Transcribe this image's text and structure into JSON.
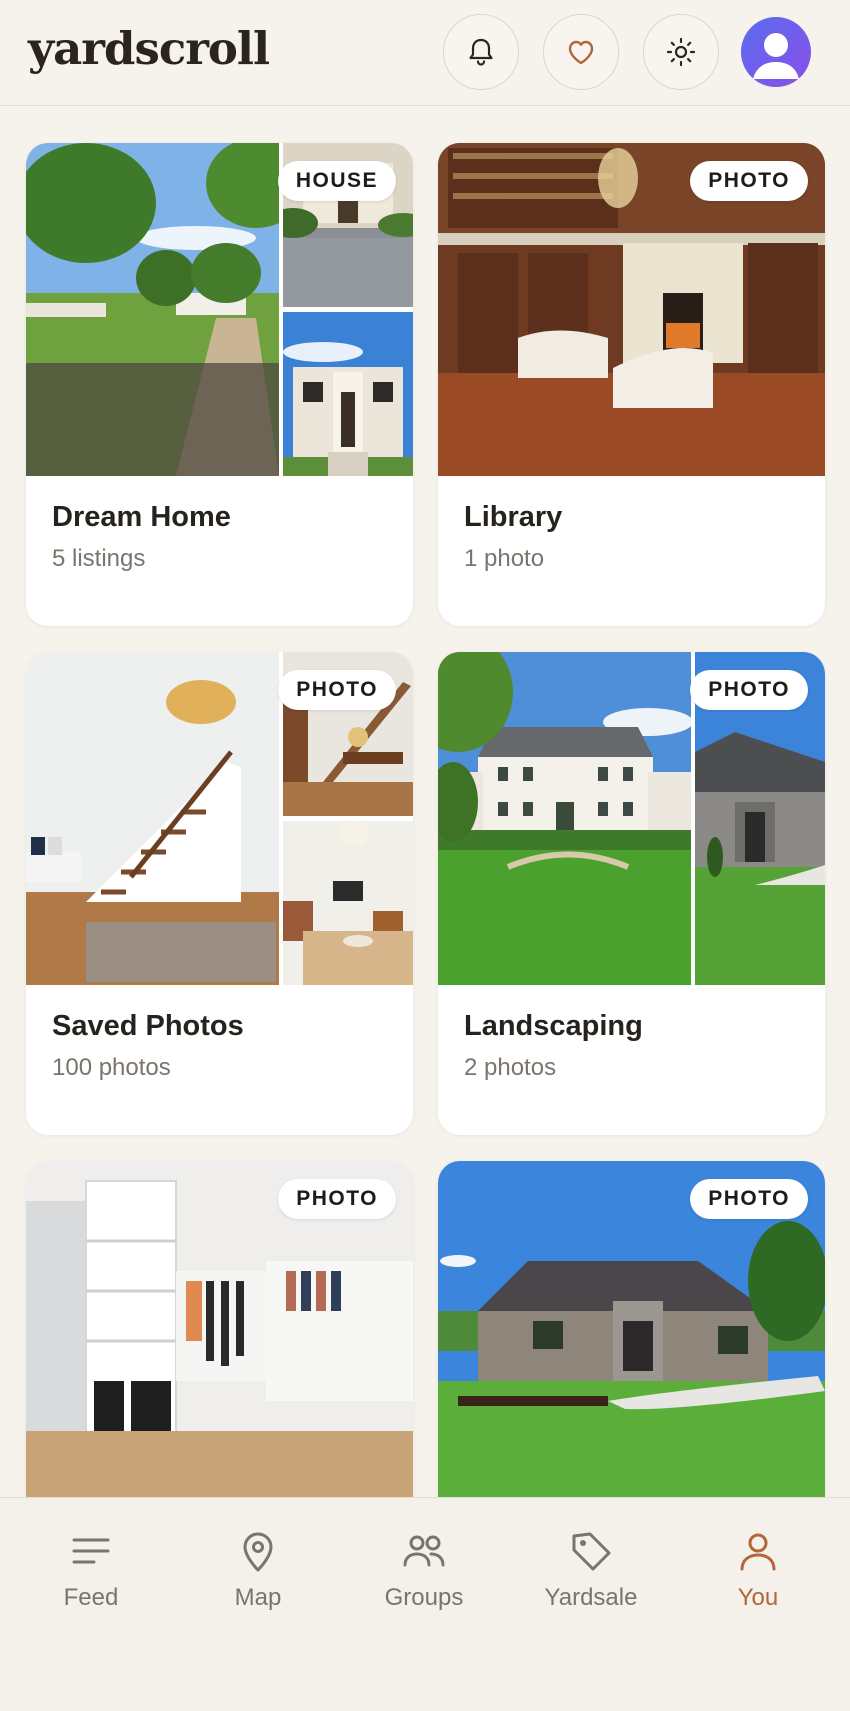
{
  "app": {
    "title": "yardscroll",
    "accent_color": "#b4653a",
    "header_icons": [
      "bell-icon",
      "heart-icon",
      "sun-icon",
      "user-avatar-icon"
    ]
  },
  "collections": [
    {
      "title": "Dream Home",
      "subtitle": "5 listings",
      "badge": "HOUSE"
    },
    {
      "title": "Library",
      "subtitle": "1 photo",
      "badge": "PHOTO"
    },
    {
      "title": "Saved Photos",
      "subtitle": "100 photos",
      "badge": "PHOTO"
    },
    {
      "title": "Landscaping",
      "subtitle": "2 photos",
      "badge": "PHOTO"
    },
    {
      "title": "",
      "subtitle": "",
      "badge": "PHOTO"
    },
    {
      "title": "",
      "subtitle": "",
      "badge": "PHOTO"
    }
  ],
  "nav": {
    "items": [
      {
        "label": "Feed",
        "icon": "feed-icon",
        "active": false
      },
      {
        "label": "Map",
        "icon": "map-pin-icon",
        "active": false
      },
      {
        "label": "Groups",
        "icon": "groups-icon",
        "active": false
      },
      {
        "label": "Yardsale",
        "icon": "tag-icon",
        "active": false
      },
      {
        "label": "You",
        "icon": "user-icon",
        "active": true
      }
    ]
  }
}
